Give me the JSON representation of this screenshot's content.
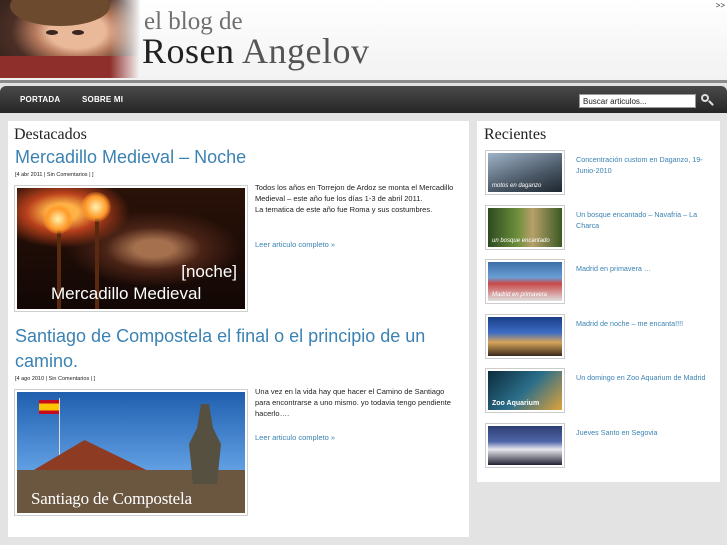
{
  "header": {
    "blog_prefix": "el blog de",
    "first_name": "Rosen",
    "last_name": "Angelov",
    "corner_link": ">>"
  },
  "nav": {
    "items": [
      "PORTADA",
      "SOBRE MI"
    ],
    "search_placeholder": "Buscar articulos..."
  },
  "main": {
    "section_title": "Destacados",
    "posts": [
      {
        "title": "Mercadillo Medieval – Noche",
        "meta": "[4 abr 2011 | Sin Comentarios | ]",
        "excerpt": "Todos los años en Torrejon de Ardoz se monta el Mercadillo Medieval – este año fue los días 1-3 de abril 2011.\nLa tematica de este año fue Roma y sus costumbres.",
        "read_more": "Leer articulo completo »",
        "image_text": [
          "[noche]",
          "Mercadillo Medieval"
        ]
      },
      {
        "title": "Santiago de Compostela el final o el principio de un camino.",
        "meta": "[4 ago 2010 | Sin Comentarios | ]",
        "excerpt": "Una vez en la vida hay que hacer el Camino de Santiago para encontrarse a uno mismo. yo todavia tengo pendiente hacerlo….",
        "read_more": "Leer articulo completo »",
        "image_text": [
          "Santiago de Compostela"
        ]
      }
    ]
  },
  "sidebar": {
    "title": "Recientes",
    "items": [
      {
        "title": "Concentración custom en Daganzo, 19-Junio-2010",
        "thumb_label": "motos en daganzo"
      },
      {
        "title": "Un bosque encantado – Navafria – La Charca",
        "thumb_label": "un bosque encantado"
      },
      {
        "title": "Madrid en primavera …",
        "thumb_label": "Madrid en primavera"
      },
      {
        "title": "Madrid de noche – me encanta!!!!",
        "thumb_label": ""
      },
      {
        "title": "Un domingo en Zoo Aquarium de Madrid",
        "thumb_label": "Zoo Aquarium"
      },
      {
        "title": "Jueves Santo en Segovia",
        "thumb_label": ""
      }
    ]
  },
  "colors": {
    "link": "#3b82b3",
    "nav_bg": "#333333",
    "page_bg": "#e3e3e3"
  }
}
